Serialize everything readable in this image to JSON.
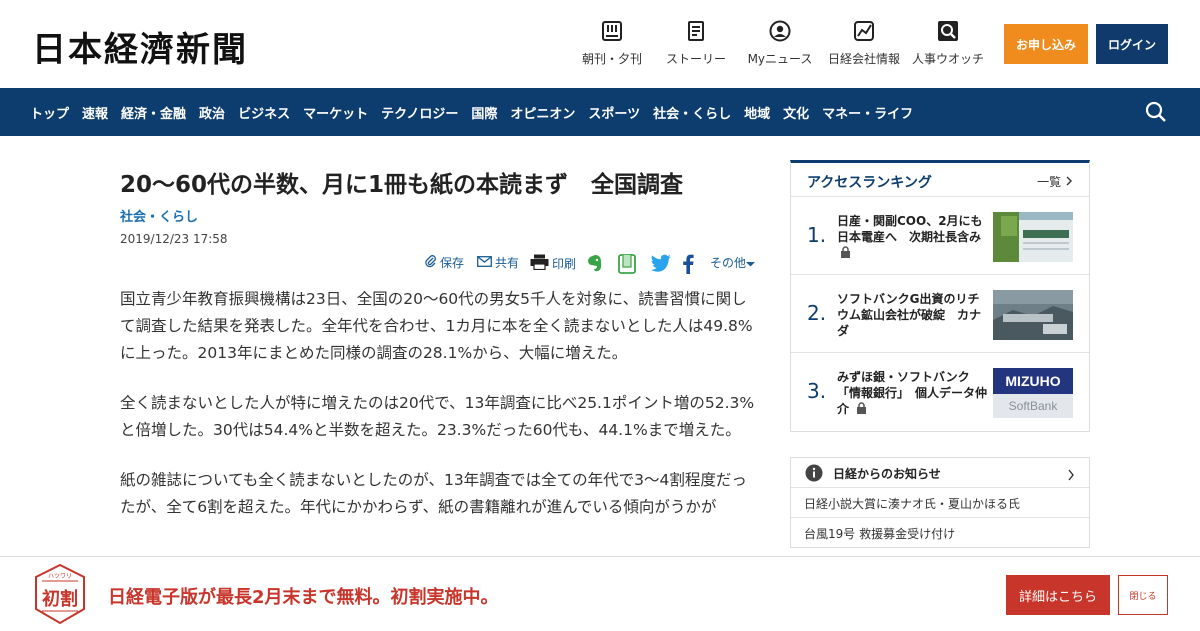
{
  "header": {
    "logo": "日本経濟新聞",
    "nav": [
      {
        "label": "朝刊・夕刊",
        "icon": "newspaper-icon"
      },
      {
        "label": "ストーリー",
        "icon": "document-icon"
      },
      {
        "label": "Myニュース",
        "icon": "user-icon"
      },
      {
        "label": "日経会社情報",
        "icon": "chart-icon"
      },
      {
        "label": "人事ウオッチ",
        "icon": "search-person-icon"
      }
    ],
    "subscribe_label": "お申し込み",
    "login_label": "ログイン"
  },
  "navbar": {
    "items": [
      "トップ",
      "速報",
      "経済・金融",
      "政治",
      "ビジネス",
      "マーケット",
      "テクノロジー",
      "国際",
      "オピニオン",
      "スポーツ",
      "社会・くらし",
      "地域",
      "文化",
      "マネー・ライフ"
    ],
    "search_icon": "search-icon"
  },
  "article": {
    "title": "20～60代の半数、月に1冊も紙の本読まず　全国調査",
    "category": "社会・くらし",
    "date": "2019/12/23 17:58",
    "tools": {
      "save": "保存",
      "share": "共有",
      "print": "印刷",
      "other": "その他"
    },
    "paragraphs": [
      "国立青少年教育振興機構は23日、全国の20～60代の男女5千人を対象に、読書習慣に関して調査した結果を発表した。全年代を合わせ、1カ月に本を全く読まないとした人は49.8%に上った。2013年にまとめた同様の調査の28.1%から、大幅に増えた。",
      "全く読まないとした人が特に増えたのは20代で、13年調査に比べ25.1ポイント増の52.3%と倍増した。30代は54.4%と半数を超えた。23.3%だった60代も、44.1%まで増えた。",
      "紙の雑誌についても全く読まないとしたのが、13年調査では全ての年代で3～4割程度だったが、全て6割を超えた。年代にかかわらず、紙の書籍離れが進んでいる傾向がうかが"
    ]
  },
  "ranking": {
    "title": "アクセスランキング",
    "all_label": "一覧",
    "items": [
      {
        "rank": "1.",
        "text": "日産・関副COO、2月にも日本電産へ　次期社長含み"
      },
      {
        "rank": "2.",
        "text": "ソフトバンクG出資のリチウム鉱山会社が破綻　カナダ"
      },
      {
        "rank": "3.",
        "text": "みずほ銀・ソフトバンク「情報銀行」　個人データ仲介"
      }
    ],
    "thumb3_top": "MIZUHO",
    "thumb3_bottom": "SoftBank"
  },
  "notice": {
    "title": "日経からのお知らせ",
    "links": [
      "日経小説大賞に湊ナオ氏・夏山かほる氏",
      "台風19号 救援募金受け付け"
    ]
  },
  "banner": {
    "badge_small": "ハツワリ",
    "badge": "初割",
    "text": "日経電子版が最長2月末まで無料。初割実施中。",
    "detail_label": "詳細はこちら",
    "close_label": "閉じる"
  },
  "colors": {
    "navy": "#0d3d6e",
    "orange": "#f08b1d",
    "red": "#c8352b",
    "link": "#1a6fb0"
  }
}
